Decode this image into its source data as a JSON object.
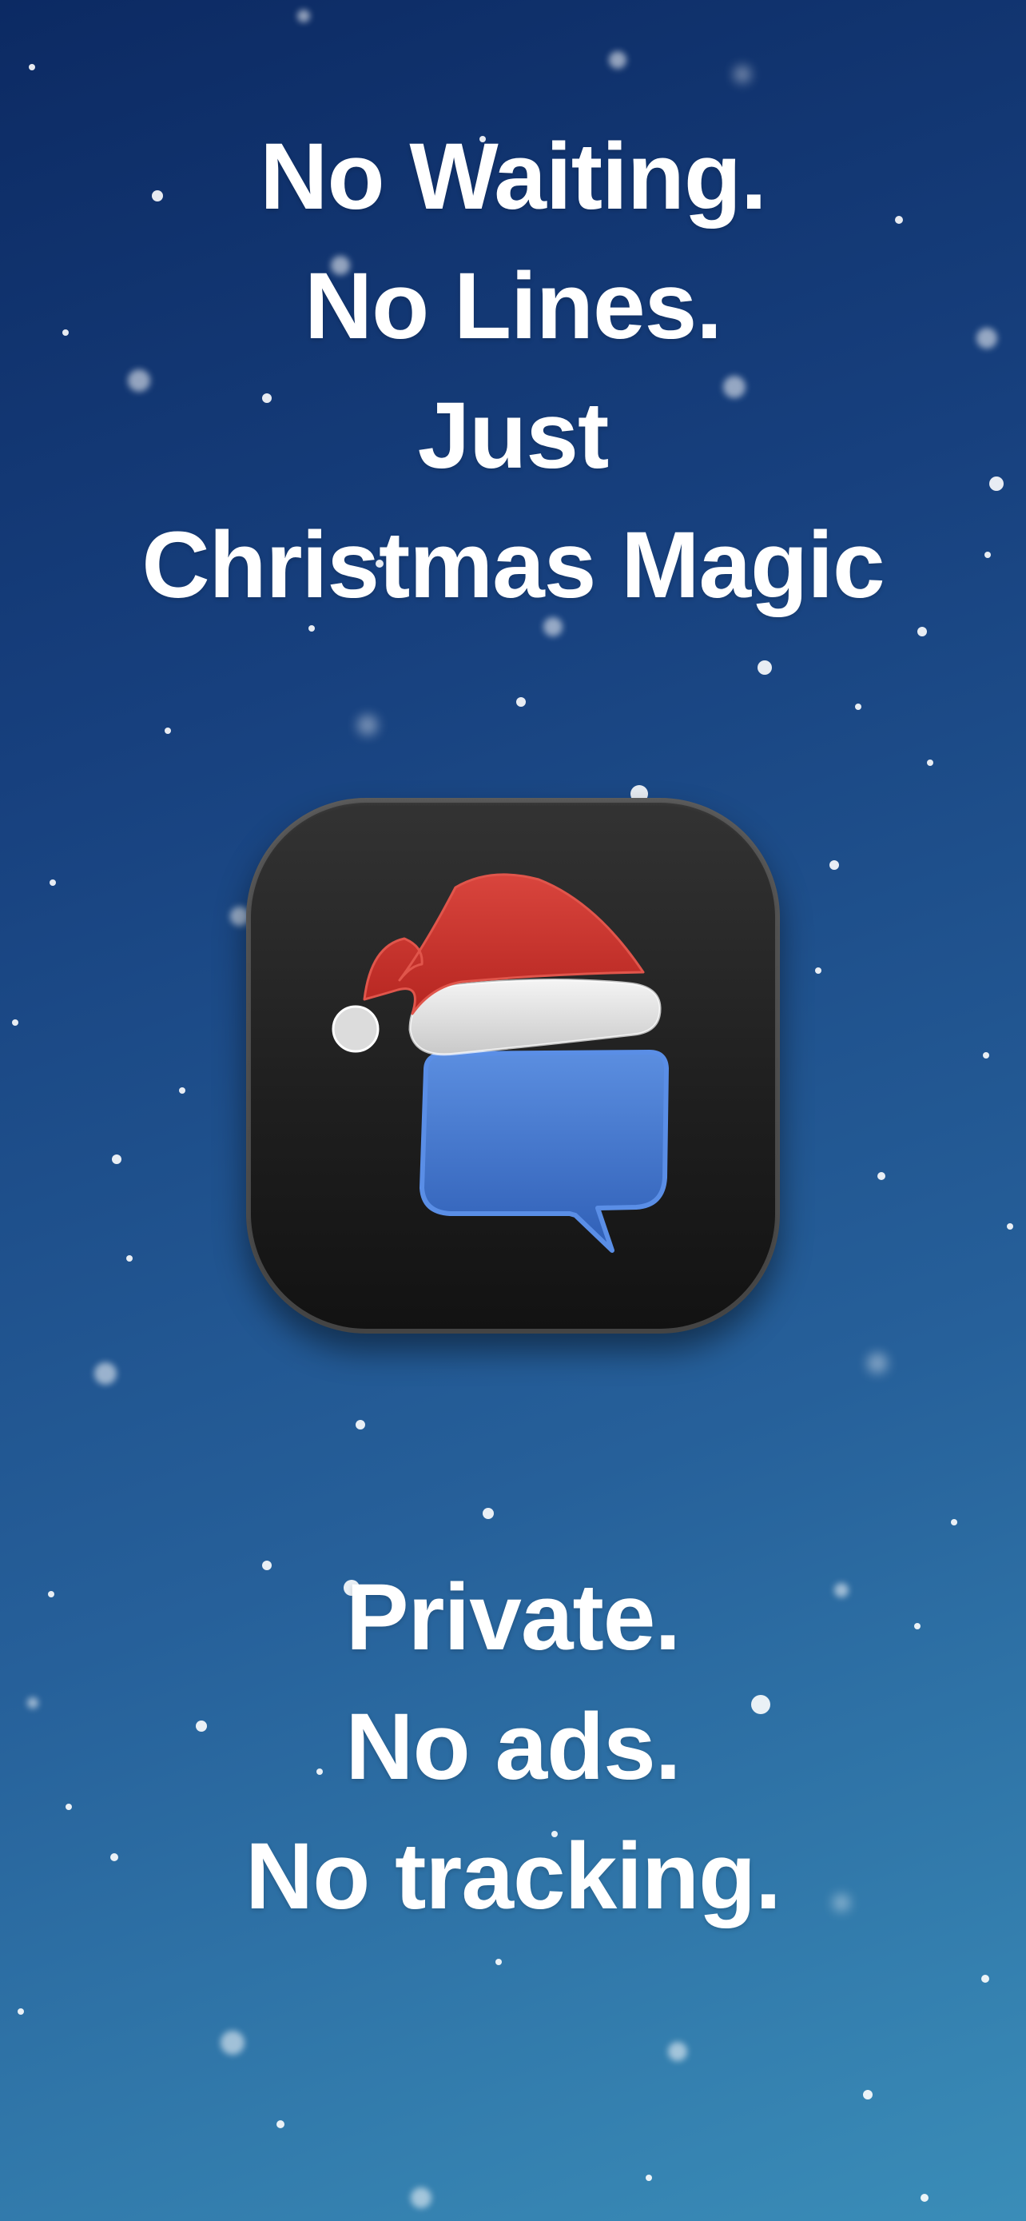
{
  "screen": {
    "headline_top": [
      "No Waiting.",
      "No Lines.",
      "Just",
      "Christmas Magic"
    ],
    "app_icon": {
      "icon": "santa-hat-chat-bubble-icon"
    },
    "headline_bottom": [
      "Private.",
      "No ads.",
      "No tracking."
    ]
  },
  "colors": {
    "background_top": "#0c2a63",
    "background_bottom": "#3a8db8",
    "text": "#ffffff",
    "icon_tile": "#1f1f1f",
    "hat_red": "#c8302b",
    "hat_trim": "#e6e6e6",
    "bubble_blue": "#3d74cf"
  }
}
